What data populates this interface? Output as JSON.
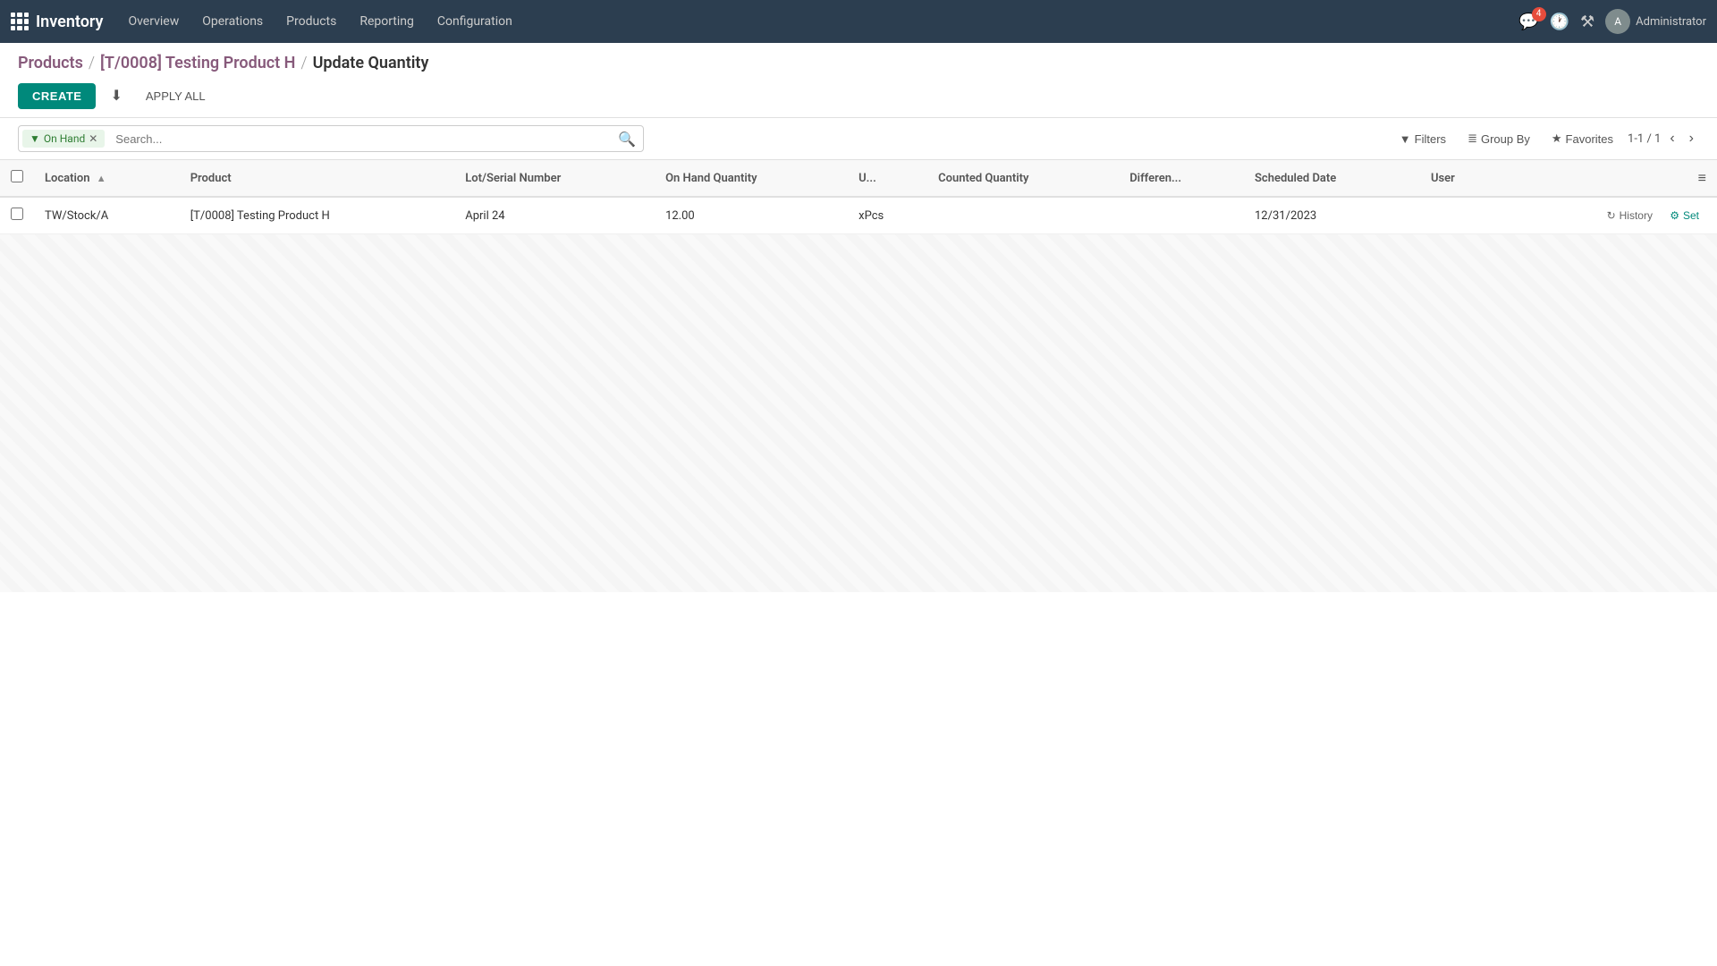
{
  "topnav": {
    "brand": "Inventory",
    "menu": [
      {
        "label": "Overview",
        "id": "overview"
      },
      {
        "label": "Operations",
        "id": "operations"
      },
      {
        "label": "Products",
        "id": "products"
      },
      {
        "label": "Reporting",
        "id": "reporting"
      },
      {
        "label": "Configuration",
        "id": "configuration"
      }
    ],
    "notification_count": "4",
    "user_label": "Administrator"
  },
  "breadcrumb": {
    "parts": [
      {
        "label": "Products",
        "link": true
      },
      {
        "label": "[T/0008] Testing Product H",
        "link": true
      },
      {
        "label": "Update Quantity",
        "link": false
      }
    ]
  },
  "toolbar": {
    "create_label": "CREATE",
    "apply_all_label": "APPLY ALL"
  },
  "search": {
    "filter_tag": "On Hand",
    "placeholder": "Search...",
    "filters_label": "Filters",
    "group_by_label": "Group By",
    "favorites_label": "Favorites"
  },
  "pagination": {
    "current": "1-1 / 1"
  },
  "table": {
    "columns": [
      {
        "label": "Location",
        "id": "location",
        "sortable": true,
        "sort_dir": "asc"
      },
      {
        "label": "Product",
        "id": "product",
        "sortable": false
      },
      {
        "label": "Lot/Serial Number",
        "id": "lot",
        "sortable": false
      },
      {
        "label": "On Hand Quantity",
        "id": "on_hand",
        "sortable": false
      },
      {
        "label": "U...",
        "id": "uom",
        "sortable": false
      },
      {
        "label": "Counted Quantity",
        "id": "counted",
        "sortable": false
      },
      {
        "label": "Differen...",
        "id": "diff",
        "sortable": false
      },
      {
        "label": "Scheduled Date",
        "id": "sched_date",
        "sortable": false
      },
      {
        "label": "User",
        "id": "user",
        "sortable": false
      }
    ],
    "rows": [
      {
        "location": "TW/Stock/A",
        "product": "[T/0008] Testing Product H",
        "lot": "April 24",
        "on_hand": "12.00",
        "uom": "xPcs",
        "counted": "",
        "diff": "",
        "sched_date": "12/31/2023",
        "user": "",
        "history_label": "History",
        "set_label": "Set"
      }
    ]
  }
}
